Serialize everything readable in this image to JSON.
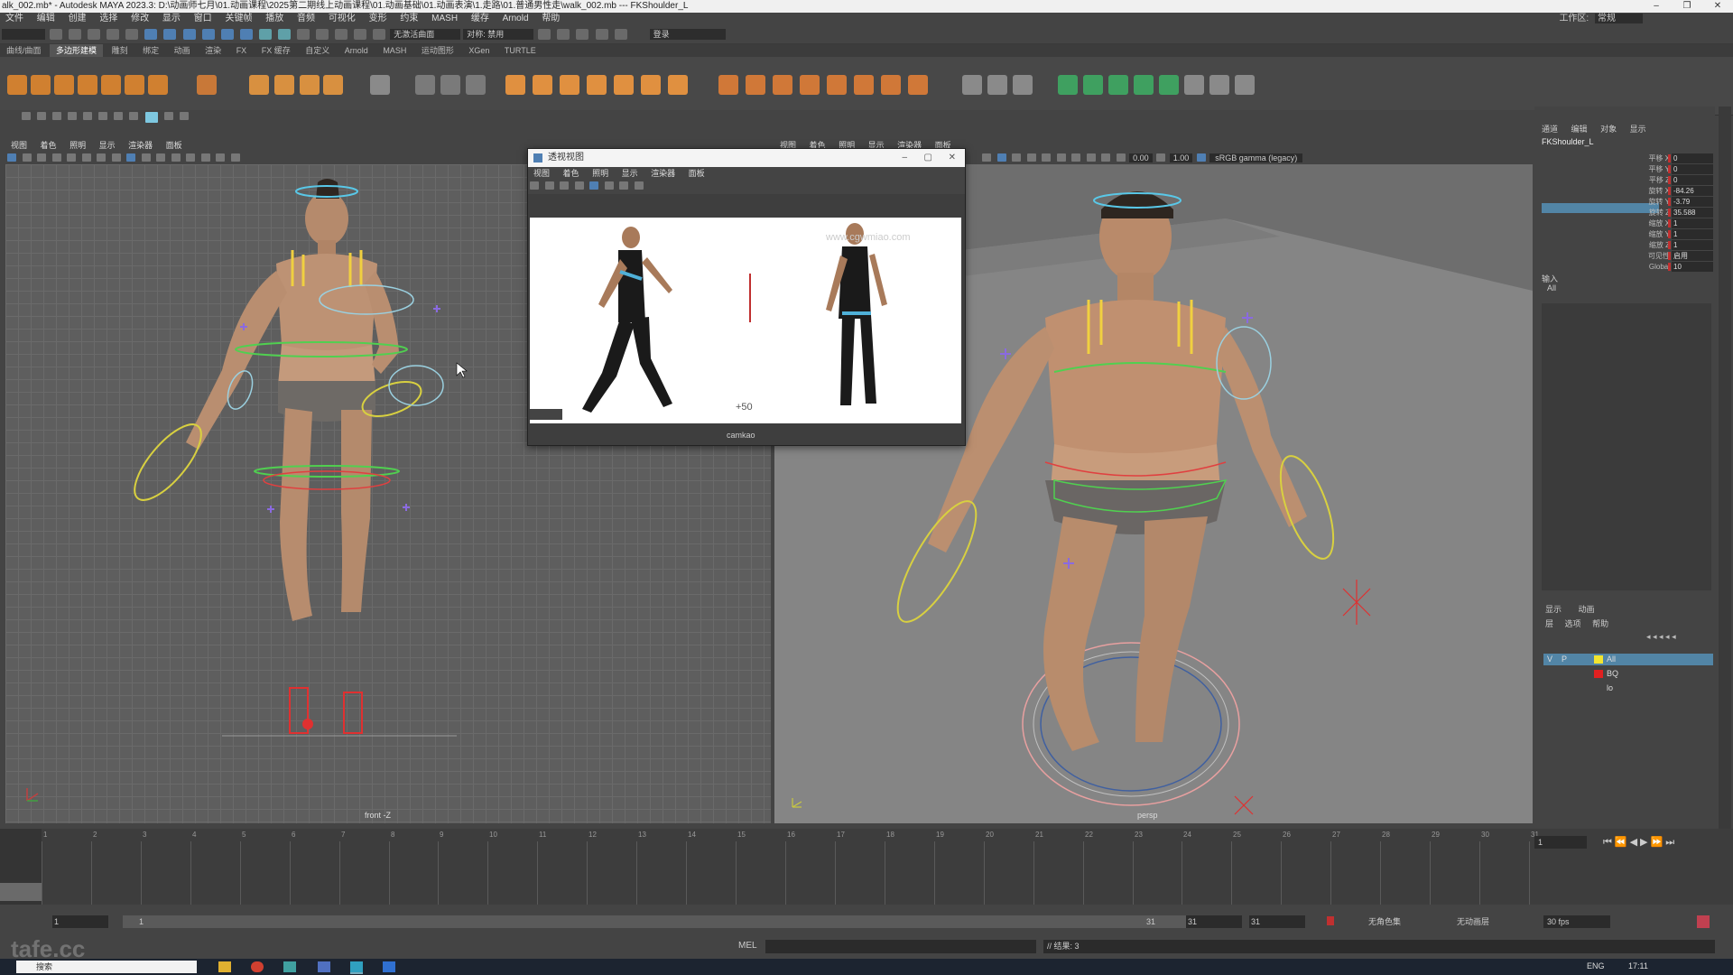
{
  "window": {
    "title": "alk_002.mb* - Autodesk MAYA 2023.3: D:\\动画师七月\\01.动画课程\\2025第二期线上动画课程\\01.动画基础\\01.动画表演\\1.走路\\01.普通男性走\\walk_002.mb   ---   FKShoulder_L",
    "controls": [
      "–",
      "❐",
      "✕"
    ]
  },
  "menubar": {
    "items": [
      "文件",
      "编辑",
      "创建",
      "选择",
      "修改",
      "显示",
      "窗口",
      "关键帧",
      "播放",
      "音频",
      "可视化",
      "变形",
      "约束",
      "MASH",
      "缓存",
      "Arnold",
      "帮助"
    ],
    "workspace_label": "工作区:",
    "workspace_value": "常规"
  },
  "statusline": {
    "no_live_surface": "无激活曲面",
    "symmetry": "对称: 禁用",
    "login": "登录"
  },
  "shelf": {
    "tabs": [
      "曲线/曲面",
      "多边形建模",
      "雕刻",
      "绑定",
      "动画",
      "渲染",
      "FX",
      "FX 缓存",
      "自定义",
      "Arnold",
      "MASH",
      "运动图形",
      "XGen",
      "TURTLE"
    ],
    "active_tab": "多边形建模"
  },
  "front_viewport": {
    "menus": [
      "视图",
      "着色",
      "照明",
      "显示",
      "渲染器",
      "面板"
    ],
    "camera_label": "front -Z"
  },
  "persp_viewport": {
    "menus": [
      "视图",
      "着色",
      "照明",
      "显示",
      "渲染器",
      "面板"
    ],
    "camera_label": "persp",
    "exposure": "0.00",
    "gamma": "1.00",
    "color_space": "sRGB gamma (legacy)"
  },
  "float_window": {
    "title": "透视视图",
    "menus": [
      "视图",
      "着色",
      "照明",
      "显示",
      "渲染器",
      "面板"
    ],
    "watermark": "www.cgwmiao.com",
    "offset_label": "+50",
    "camera_label": "camkao"
  },
  "channel_box": {
    "tabs": [
      "通道",
      "编辑",
      "对象",
      "显示"
    ],
    "object_name": "FKShoulder_L",
    "attributes": [
      {
        "name": "平移 X",
        "value": "0"
      },
      {
        "name": "平移 Y",
        "value": "0"
      },
      {
        "name": "平移 Z",
        "value": "0"
      },
      {
        "name": "旋转 X",
        "value": "-84.26"
      },
      {
        "name": "旋转 Y",
        "value": "-3.79"
      },
      {
        "name": "旋转 Z",
        "value": "35.588"
      },
      {
        "name": "缩放 X",
        "value": "1"
      },
      {
        "name": "缩放 Y",
        "value": "1"
      },
      {
        "name": "缩放 Z",
        "value": "1"
      },
      {
        "name": "可见性",
        "value": "启用"
      },
      {
        "name": "Global",
        "value": "10"
      }
    ],
    "inputs_label": "输入",
    "inputs_value": "All"
  },
  "layer_editor": {
    "tabs": [
      "显示",
      "动画"
    ],
    "menus": [
      "层",
      "选项",
      "帮助"
    ],
    "layers": [
      {
        "name": "All",
        "color": "#f2e530",
        "v": "V",
        "p": "P"
      },
      {
        "name": "BQ",
        "color": "#e02020",
        "v": "",
        "p": ""
      },
      {
        "name": "lo",
        "color": "",
        "v": "",
        "p": ""
      }
    ]
  },
  "timeline": {
    "ticks": [
      "1",
      "2",
      "3",
      "4",
      "5",
      "6",
      "7",
      "8",
      "9",
      "10",
      "11",
      "12",
      "13",
      "14",
      "15",
      "16",
      "17",
      "18",
      "19",
      "20",
      "21",
      "22",
      "23",
      "24",
      "25",
      "26",
      "27",
      "28",
      "29",
      "30",
      "31"
    ],
    "current_frame": "1"
  },
  "range_slider": {
    "start": "1",
    "start_inner": "1",
    "end_inner": "31",
    "end": "31",
    "end_outer": "31",
    "char_set": "无角色集",
    "anim_layer": "无动画层",
    "fps": "30 fps"
  },
  "command_line": {
    "lang": "MEL",
    "result": "// 结果: 3"
  },
  "taskbar": {
    "search": "搜索",
    "lang": "ENG",
    "time": "17:11"
  },
  "watermark_corner": "tafe.cc",
  "colors": {
    "accent_blue": "#4f7fb3",
    "selected_row": "#5285a6",
    "key_red": "#c03030"
  }
}
